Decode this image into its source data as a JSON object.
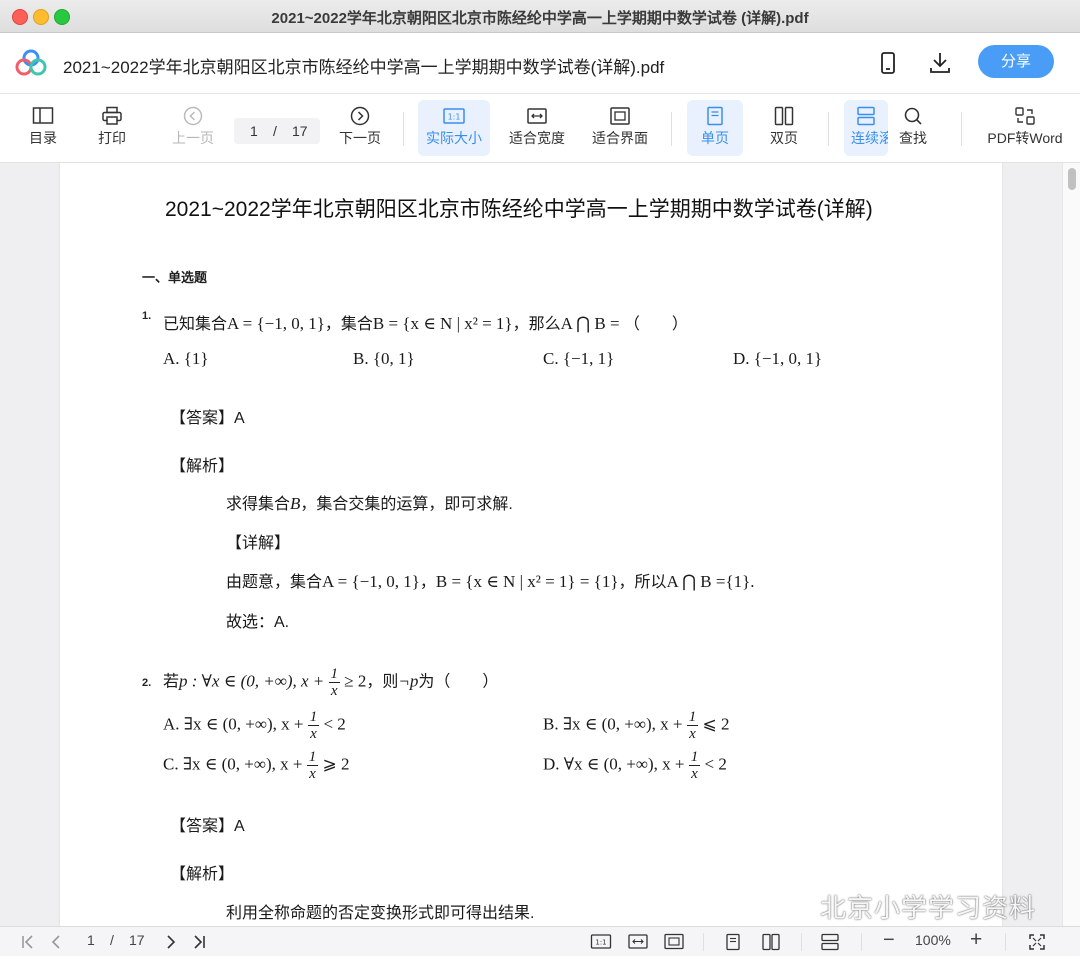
{
  "window": {
    "title": "2021~2022学年北京朝阳区北京市陈经纶中学高一上学期期中数学试卷 (详解).pdf"
  },
  "header": {
    "doc_title": "2021~2022学年北京朝阳区北京市陈经纶中学高一上学期期中数学试卷(详解).pdf",
    "share_label": "分享",
    "icons": [
      "app-logo-icon",
      "mobile-icon",
      "download-icon"
    ]
  },
  "toolbar": {
    "toc": "目录",
    "print": "打印",
    "prev": "上一页",
    "next": "下一页",
    "page_current": "1",
    "page_sep": "/",
    "page_total": "17",
    "actual_size": "实际大小",
    "fit_width": "适合宽度",
    "fit_page": "适合界面",
    "single": "单页",
    "double": "双页",
    "continuous": "连续滚",
    "find": "查找",
    "to_word": "PDF转Word",
    "active": [
      "实际大小",
      "单页",
      "连续滚"
    ]
  },
  "doc": {
    "title": "2021~2022学年北京朝阳区北京市陈经纶中学高一上学期期中数学试卷(详解)",
    "section": "一、单选题",
    "q1": {
      "num": "1.",
      "stem_a": "已知集合",
      "stem_b": "A = {−1, 0, 1}",
      "stem_c": "，集合",
      "stem_d": "B = {x ∈ N | x² = 1}",
      "stem_e": "，那么",
      "stem_f": "A ⋂ B = ",
      "stem_g": "（　　）",
      "opt_a": "A. {1}",
      "opt_b": "B. {0, 1}",
      "opt_c": "C. {−1, 1}",
      "opt_d": "D. {−1, 0, 1}",
      "answer": "【答案】A",
      "analysis": "【解析】",
      "analysis_text_a": "求得集合",
      "analysis_text_b": "B",
      "analysis_text_c": "，集合交集的运算，即可求解.",
      "detail": "【详解】",
      "detail_a": "由题意，集合",
      "detail_b": "A = {−1, 0, 1}",
      "detail_c": "，",
      "detail_d": "B = {x ∈ N | x² = 1} = {1}",
      "detail_e": "，所以",
      "detail_f": "A ⋂ B ={1}.",
      "choose": "故选：A."
    },
    "q2": {
      "num": "2.",
      "stem_a": "若",
      "stem_b": "p : ∀x ∈ (0, +∞), x + ",
      "frac_num": "1",
      "frac_den": "x",
      "stem_c": " ≥ 2",
      "stem_d": "，则",
      "stem_e": "¬p",
      "stem_f": "为（　　）",
      "opt_a_pre": "A. ∃x ∈ (0, +∞), x + ",
      "opt_a_post": " < 2",
      "opt_b_pre": "B. ∃x ∈ (0, +∞), x + ",
      "opt_b_post": " ⩽ 2",
      "opt_c_pre": "C. ∃x ∈ (0, +∞), x + ",
      "opt_c_post": " ⩾ 2",
      "opt_d_pre": "D. ∀x ∈ (0, +∞), x + ",
      "opt_d_post": " < 2",
      "answer": "【答案】A",
      "analysis": "【解析】",
      "analysis_text": "利用全称命题的否定变换形式即可得出结果."
    }
  },
  "statusbar": {
    "page_current": "1",
    "page_sep": "/",
    "page_total": "17",
    "zoom": "100%",
    "zoom_out": "−",
    "zoom_in": "+"
  },
  "watermark": "北京小学学习资料"
}
